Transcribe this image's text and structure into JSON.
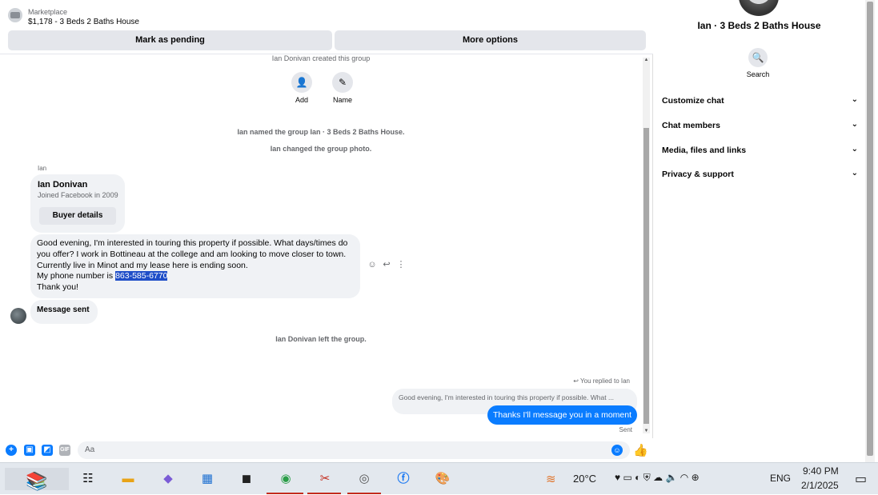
{
  "topbar": {
    "marketplace_label": "Marketplace",
    "listing_title": "$1,178 - 3 Beds 2 Baths House",
    "pending_button": "Mark as pending",
    "more_button": "More options"
  },
  "thread": {
    "created_line": "Ian Donivan created this group",
    "add_label": "Add",
    "name_label": "Name",
    "named_line": "Ian named the group Ian · 3 Beds 2 Baths House.",
    "photo_line": "Ian changed the group photo.",
    "sender": "Ian",
    "card": {
      "name": "Ian Donivan",
      "joined": "Joined Facebook in 2009",
      "button": "Buyer details"
    },
    "message": {
      "line1": "Good evening, I'm interested in touring this property if possible. What days/times do",
      "line2": "you offer? I work in Bottineau at the college and am looking to move closer to town.",
      "line3": "Currently live in Minot and my lease here is ending soon.",
      "line4_prefix": "My phone number is ",
      "phone": "863-585-6770",
      "line5": "Thank you!"
    },
    "message_sent": "Message sent",
    "left_line": "Ian Donivan left the group.",
    "replied_label": "You replied to Ian",
    "quoted_text": "Good evening, I'm interested in touring this property if possible. What ...",
    "reply_text": "Thanks I'll message you in a moment",
    "sent_status": "Sent"
  },
  "composer": {
    "placeholder": "Aa",
    "icons": [
      "plus-icon",
      "photo-icon",
      "sticker-icon",
      "gif-icon",
      "emoji-icon",
      "like-icon"
    ]
  },
  "side": {
    "title": "Ian · 3 Beds 2 Baths House",
    "search_label": "Search",
    "menu": [
      {
        "label": "Customize chat"
      },
      {
        "label": "Chat members"
      },
      {
        "label": "Media, files and links"
      },
      {
        "label": "Privacy & support"
      }
    ]
  },
  "taskbar": {
    "temperature": "20°C",
    "language": "ENG",
    "time": "9:40 PM",
    "date": "2/1/2025"
  },
  "colors": {
    "accent": "#0a7cff",
    "bubble_gray": "#f0f2f5",
    "button_gray": "#e4e6eb"
  }
}
